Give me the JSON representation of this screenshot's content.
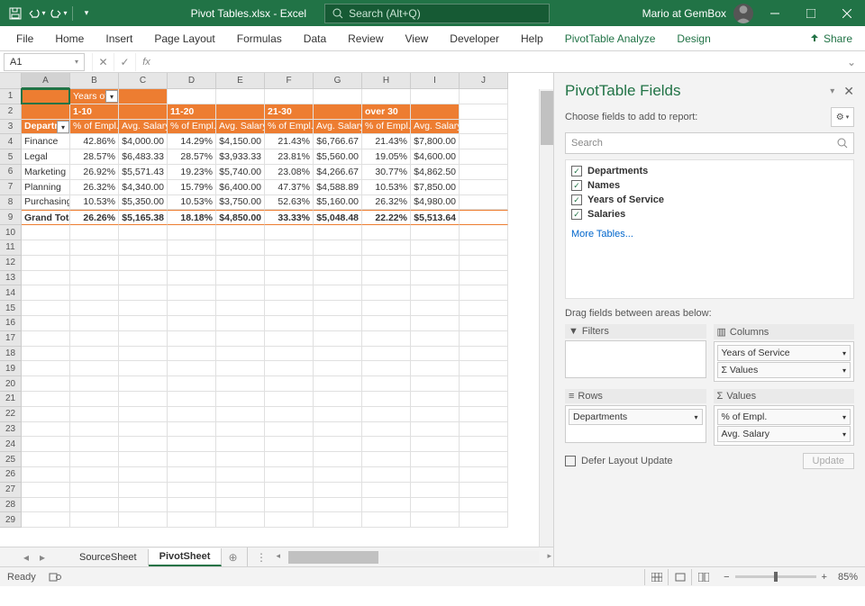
{
  "titlebar": {
    "doc": "Pivot Tables.xlsx  -  Excel",
    "search_placeholder": "Search (Alt+Q)",
    "user": "Mario at GemBox"
  },
  "ribbon": {
    "tabs": [
      "File",
      "Home",
      "Insert",
      "Page Layout",
      "Formulas",
      "Data",
      "Review",
      "View",
      "Developer",
      "Help",
      "PivotTable Analyze",
      "Design"
    ],
    "share": "Share"
  },
  "formula_bar": {
    "cell_ref": "A1"
  },
  "columns": [
    "A",
    "B",
    "C",
    "D",
    "E",
    "F",
    "G",
    "H",
    "I",
    "J"
  ],
  "pivot": {
    "years_header": "Years of Service",
    "col_groups": [
      "1-10",
      "11-20",
      "21-30",
      "over 30"
    ],
    "row_label": "Departments",
    "val_hdr_pct": "% of Empl.",
    "val_hdr_sal": "Avg. Salary",
    "rows": [
      {
        "dept": "Finance",
        "v": [
          "42.86%",
          "$4,000.00",
          "14.29%",
          "$4,150.00",
          "21.43%",
          "$6,766.67",
          "21.43%",
          "$7,800.00"
        ]
      },
      {
        "dept": "Legal",
        "v": [
          "28.57%",
          "$6,483.33",
          "28.57%",
          "$3,933.33",
          "23.81%",
          "$5,560.00",
          "19.05%",
          "$4,600.00"
        ]
      },
      {
        "dept": "Marketing",
        "v": [
          "26.92%",
          "$5,571.43",
          "19.23%",
          "$5,740.00",
          "23.08%",
          "$4,266.67",
          "30.77%",
          "$4,862.50"
        ]
      },
      {
        "dept": "Planning",
        "v": [
          "26.32%",
          "$4,340.00",
          "15.79%",
          "$6,400.00",
          "47.37%",
          "$4,588.89",
          "10.53%",
          "$7,850.00"
        ]
      },
      {
        "dept": "Purchasing",
        "v": [
          "10.53%",
          "$5,350.00",
          "10.53%",
          "$3,750.00",
          "52.63%",
          "$5,160.00",
          "26.32%",
          "$4,980.00"
        ]
      }
    ],
    "grand_total_label": "Grand Total",
    "grand_total": [
      "26.26%",
      "$5,165.38",
      "18.18%",
      "$4,850.00",
      "33.33%",
      "$5,048.48",
      "22.22%",
      "$5,513.64"
    ]
  },
  "sheet_tabs": {
    "tabs": [
      "SourceSheet",
      "PivotSheet"
    ],
    "active": 1
  },
  "side_panel": {
    "title": "PivotTable Fields",
    "choose": "Choose fields to add to report:",
    "search": "Search",
    "fields": [
      "Departments",
      "Names",
      "Years of Service",
      "Salaries"
    ],
    "more": "More Tables...",
    "drag": "Drag fields between areas below:",
    "areas": {
      "filters": "Filters",
      "columns": "Columns",
      "rows": "Rows",
      "values": "Values",
      "col_items": [
        "Years of Service",
        "Σ  Values"
      ],
      "row_items": [
        "Departments"
      ],
      "val_items": [
        "% of Empl.",
        "Avg. Salary"
      ]
    },
    "defer": "Defer Layout Update",
    "update": "Update"
  },
  "status": {
    "ready": "Ready",
    "zoom": "85%"
  }
}
